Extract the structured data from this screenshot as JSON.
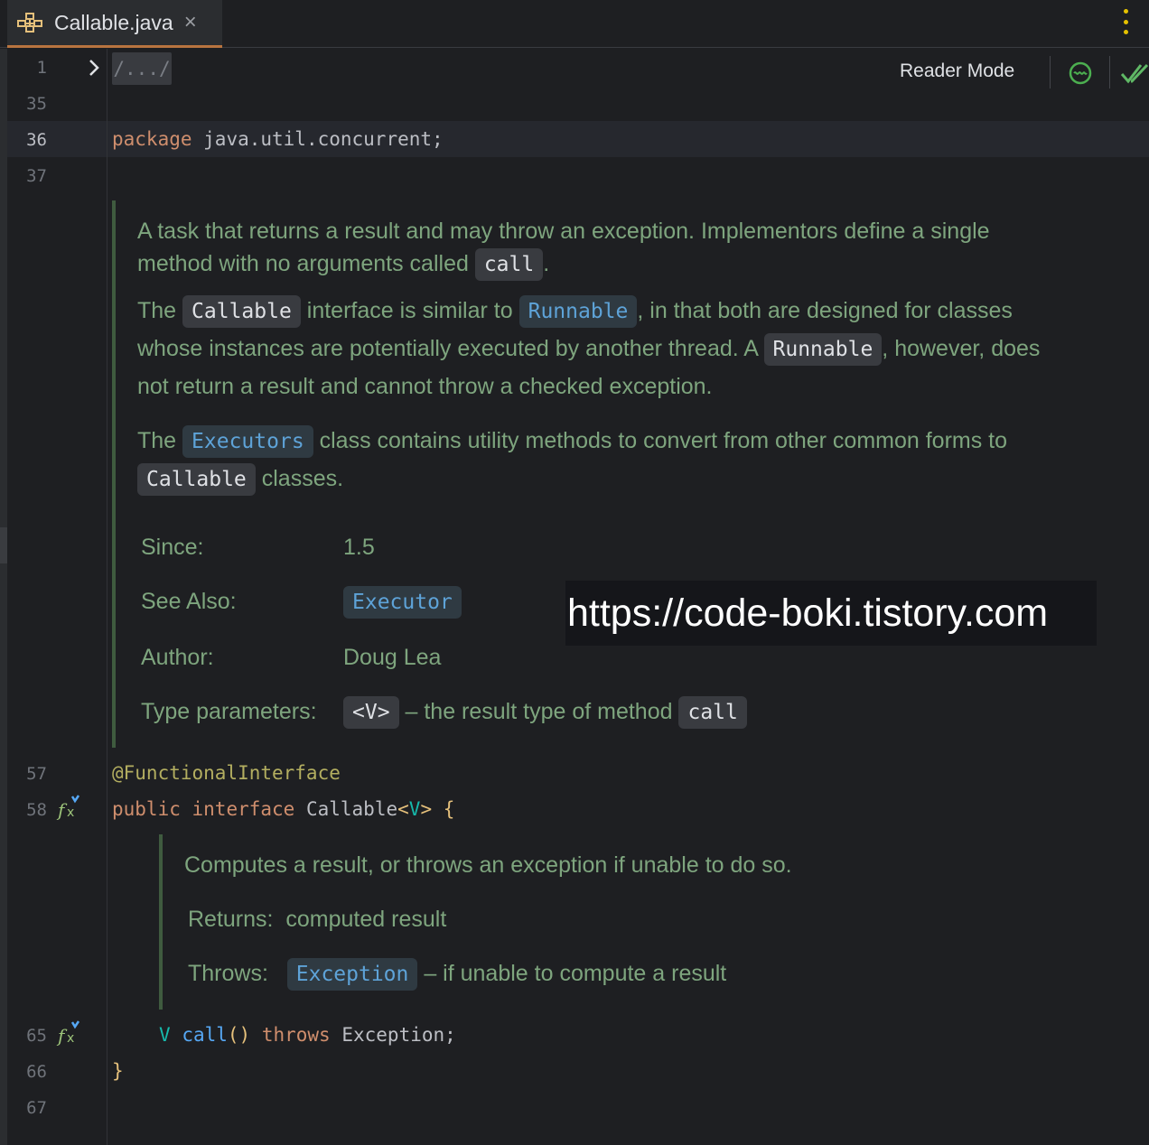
{
  "tab": {
    "label": "Callable.java",
    "icon": "class-structure-icon",
    "close": "×"
  },
  "toolbar": {
    "reader_mode": "Reader Mode"
  },
  "line_numbers": {
    "l1": "1",
    "l35": "35",
    "l36": "36",
    "l37": "37",
    "l57": "57",
    "l58": "58",
    "l65": "65",
    "l66": "66",
    "l67": "67"
  },
  "code": {
    "fold_placeholder": "/.../",
    "package_kw": "package",
    "package_name": " java.util.concurrent;",
    "annotation": "@FunctionalInterface",
    "public_kw": "public",
    "interface_kw": "interface",
    "class_name": "Callable",
    "lt": "<",
    "type_param": "V",
    "gt": ">",
    "open_brace": "{",
    "ret_type": "V",
    "method": "call",
    "parens": "()",
    "throws_kw": "throws",
    "exception": "Exception;",
    "close_brace": "}"
  },
  "doc1": {
    "p1a": "A task that returns a result and may throw an exception. Implementors define a single",
    "p1b": "method with no arguments called",
    "call": "call",
    "dot": ".",
    "p2_the": "The",
    "callable": "Callable",
    "p2_mid": "interface is similar to",
    "runnable": "Runnable",
    "p2_end": ", in that both are designed for classes",
    "p3a": "whose instances are potentially executed by another thread. A",
    "runnable2": "Runnable",
    "p3b": ", however, does",
    "p4": "not return a result and cannot throw a checked exception.",
    "p5_the": "The",
    "executors": "Executors",
    "p5_rest": "class contains utility methods to convert from other common forms to",
    "callable2": "Callable",
    "p6_rest": "classes.",
    "since_label": "Since:",
    "since_val": "1.5",
    "see_label": "See Also:",
    "see_val": "Executor",
    "author_label": "Author:",
    "author_val": "Doug Lea",
    "tparams_label": "Type parameters:",
    "tparam": "<V>",
    "tparam_desc": "– the result type of method",
    "tparam_call": "call"
  },
  "doc2": {
    "p1": "Computes a result, or throws an exception if unable to do so.",
    "returns_label": "Returns:",
    "returns_val": "computed result",
    "throws_label": "Throws:",
    "exception_link": "Exception",
    "throws_desc": "– if unable to compute a result"
  },
  "watermark": "https://code-boki.tistory.com"
}
